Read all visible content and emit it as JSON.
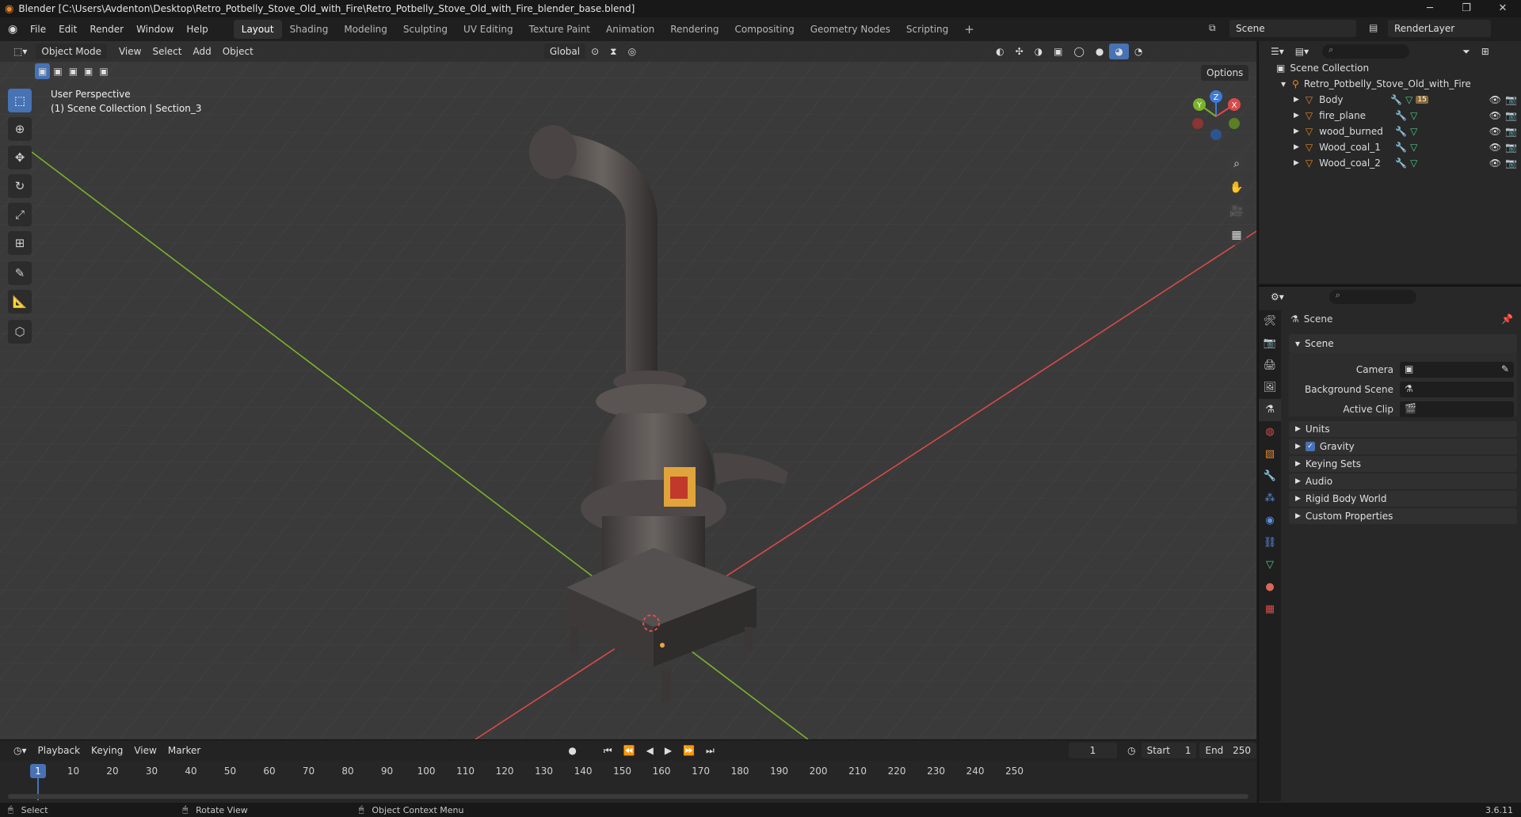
{
  "window": {
    "title": "Blender [C:\\Users\\Avdenton\\Desktop\\Retro_Potbelly_Stove_Old_with_Fire\\Retro_Potbelly_Stove_Old_with_Fire_blender_base.blend]"
  },
  "menu": [
    "File",
    "Edit",
    "Render",
    "Window",
    "Help"
  ],
  "workspaces": [
    "Layout",
    "Shading",
    "Modeling",
    "Sculpting",
    "UV Editing",
    "Texture Paint",
    "Animation",
    "Rendering",
    "Compositing",
    "Geometry Nodes",
    "Scripting"
  ],
  "active_workspace": "Layout",
  "scene_name": "Scene",
  "view_layer": "RenderLayer",
  "viewport": {
    "mode": "Object Mode",
    "menus": [
      "View",
      "Select",
      "Add",
      "Object"
    ],
    "orientation": "Global",
    "options_label": "Options",
    "overlay_line1": "User Perspective",
    "overlay_line2": "(1) Scene Collection | Section_3",
    "axis_x": "X",
    "axis_y": "Y",
    "axis_z": "Z"
  },
  "outliner": {
    "root": "Scene Collection",
    "collection": "Retro_Potbelly_Stove_Old_with_Fire",
    "objects": [
      "Body",
      "fire_plane",
      "wood_burned",
      "Wood_coal_1",
      "Wood_coal_2"
    ],
    "body_badge": "15"
  },
  "properties": {
    "context": "Scene",
    "section": "Scene",
    "camera_label": "Camera",
    "background_label": "Background Scene",
    "clip_label": "Active Clip",
    "panels": [
      "Units",
      "Gravity",
      "Keying Sets",
      "Audio",
      "Rigid Body World",
      "Custom Properties"
    ]
  },
  "timeline": {
    "menus": [
      "Playback",
      "Keying",
      "View",
      "Marker"
    ],
    "current_frame": "1",
    "start_label": "Start",
    "start": "1",
    "end_label": "End",
    "end": "250",
    "ticks": [
      "1",
      "10",
      "20",
      "30",
      "40",
      "50",
      "60",
      "70",
      "80",
      "90",
      "100",
      "110",
      "120",
      "130",
      "140",
      "150",
      "160",
      "170",
      "180",
      "190",
      "200",
      "210",
      "220",
      "230",
      "240",
      "250"
    ]
  },
  "status": {
    "select": "Select",
    "rotate": "Rotate View",
    "context_menu": "Object Context Menu",
    "version": "3.6.11"
  },
  "colors": {
    "accent": "#4772b3",
    "x_axis": "#d94a4a",
    "y_axis": "#7ab32b",
    "z_axis": "#3c7bd8",
    "mesh_icon": "#e8872a"
  }
}
